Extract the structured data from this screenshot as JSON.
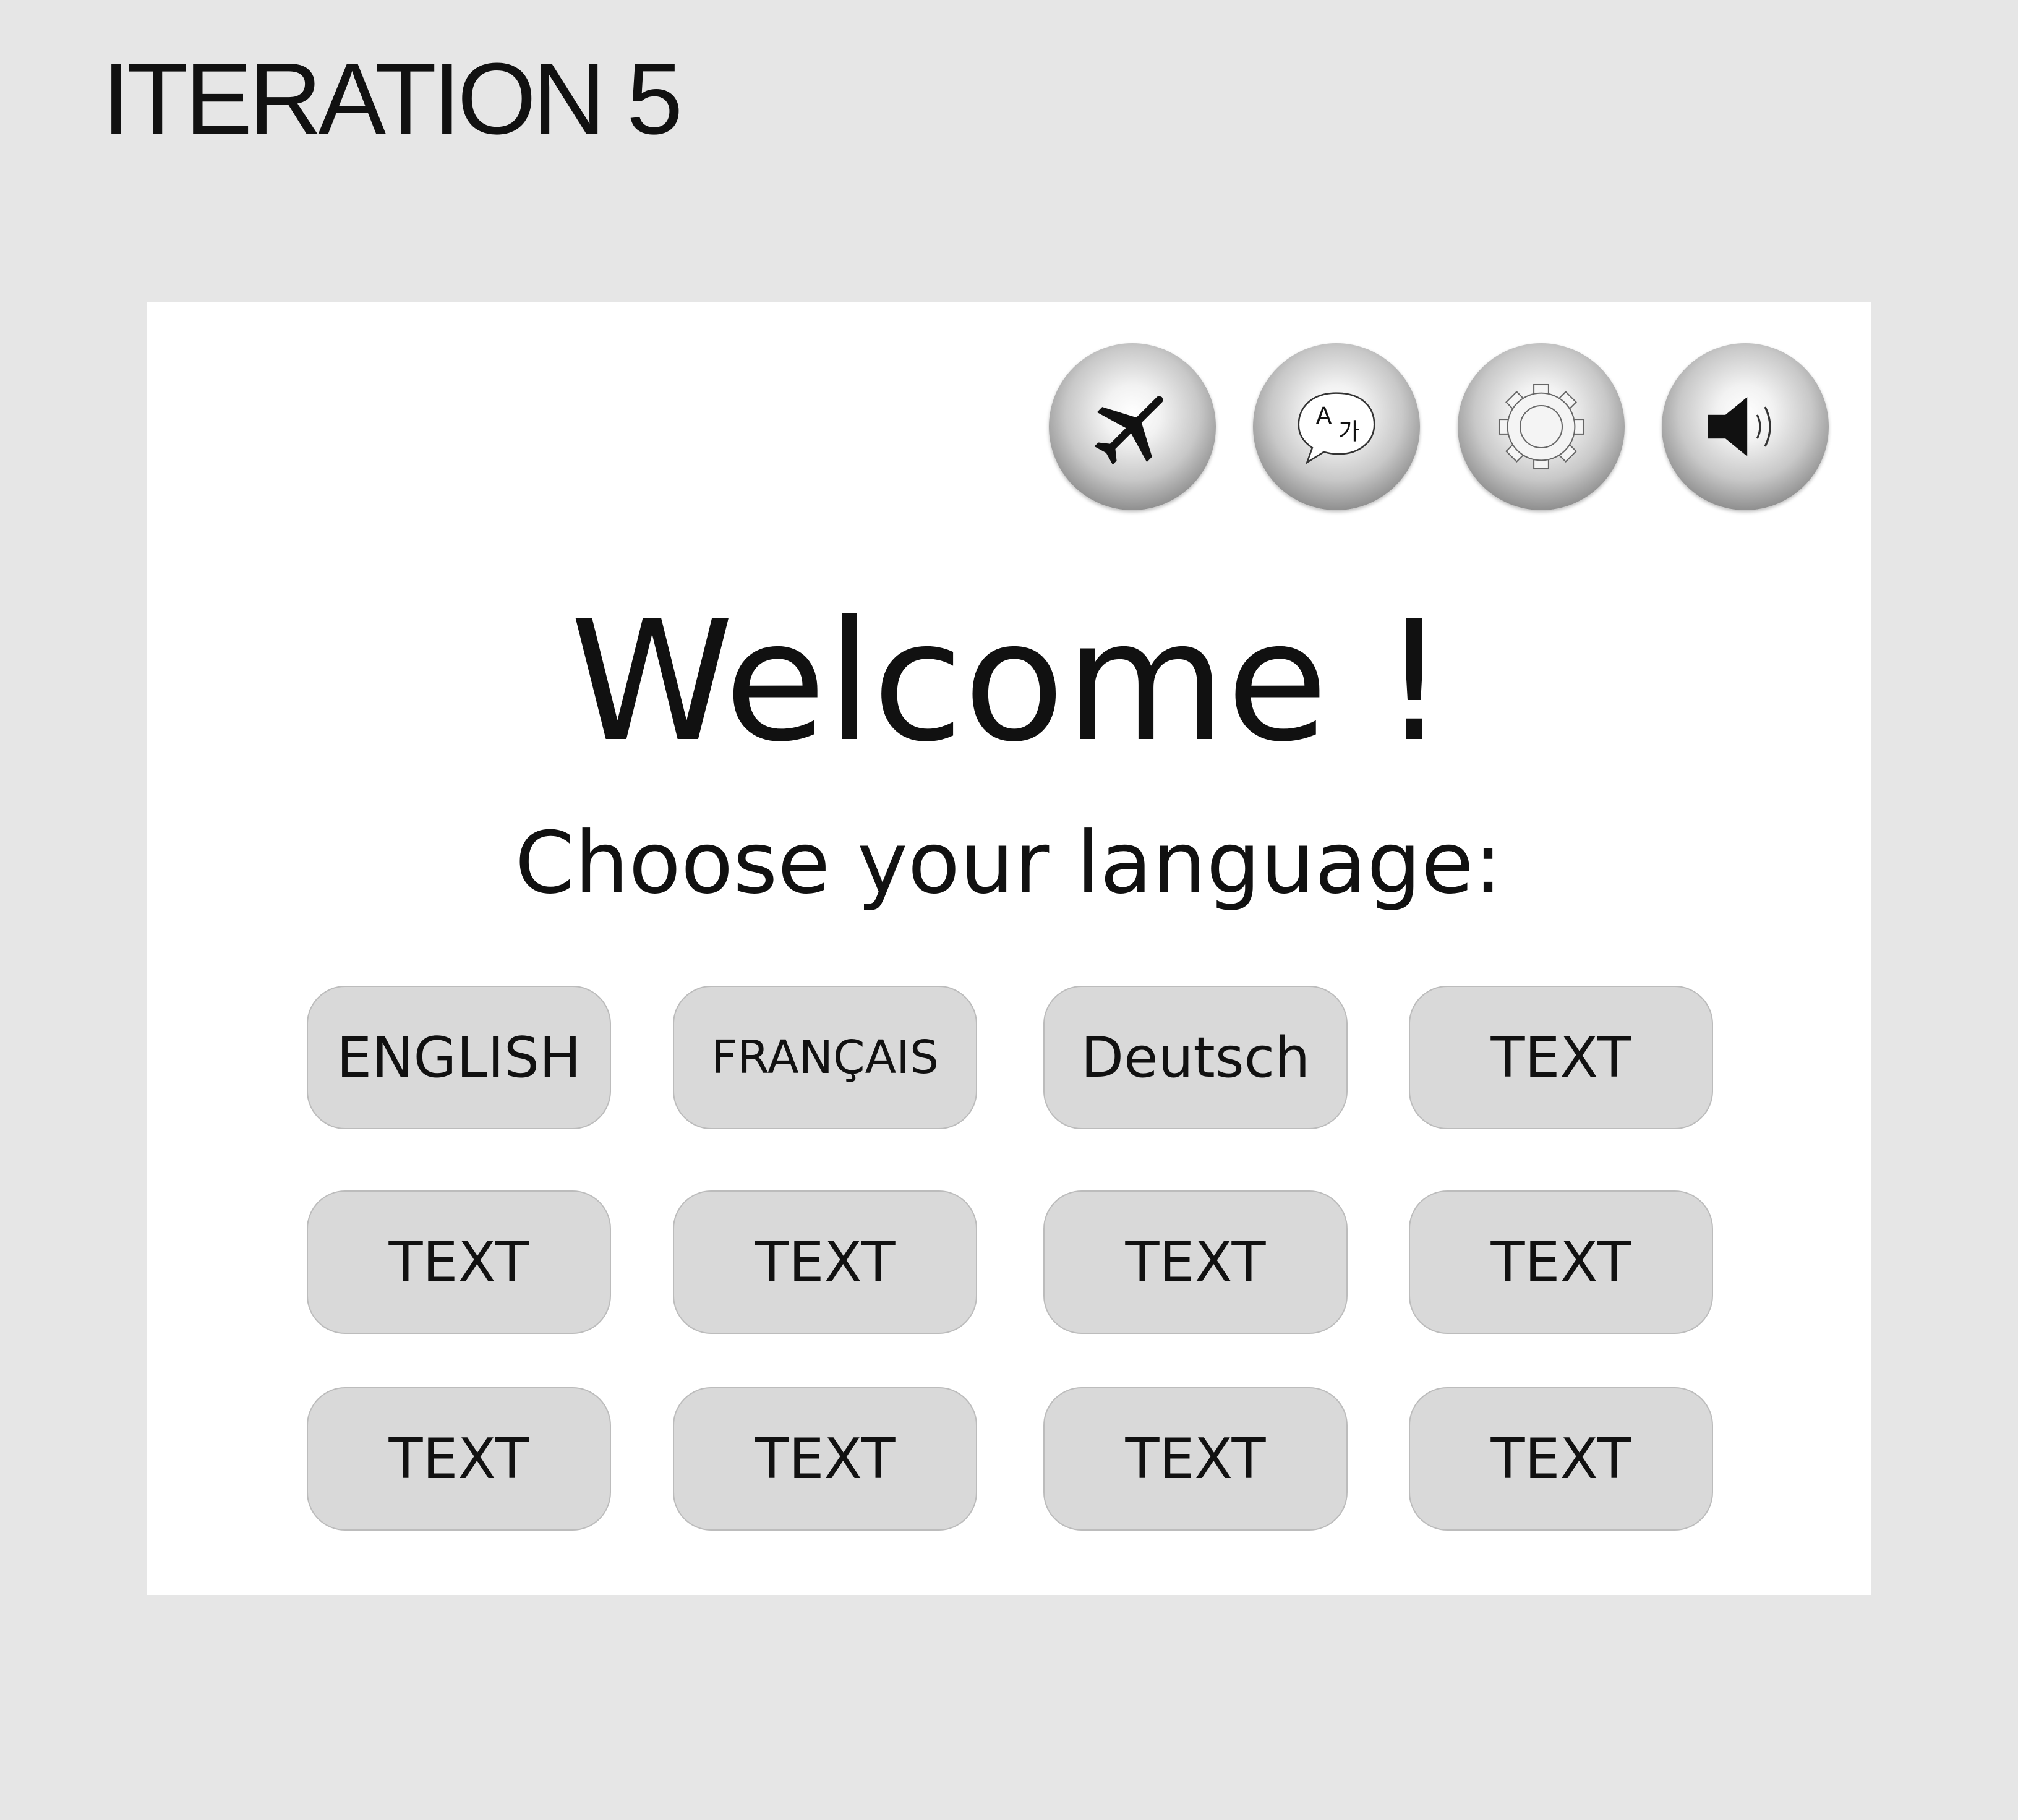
{
  "heading": "ITERATION 5",
  "toolbar": {
    "icons": [
      "airplane-icon",
      "translate-icon",
      "gear-icon",
      "speaker-icon"
    ],
    "translate_glyph_a": "A",
    "translate_glyph_ko": "가"
  },
  "welcome": "Welcome !",
  "subtitle": "Choose your language:",
  "languages": [
    "ENGLISH",
    "FRANÇAIS",
    "Deutsch",
    "TEXT",
    "TEXT",
    "TEXT",
    "TEXT",
    "TEXT",
    "TEXT",
    "TEXT",
    "TEXT",
    "TEXT"
  ],
  "colors": {
    "background": "#e6e6e6",
    "panel": "#ffffff",
    "button": "#d9d9d9",
    "text": "#111111"
  }
}
